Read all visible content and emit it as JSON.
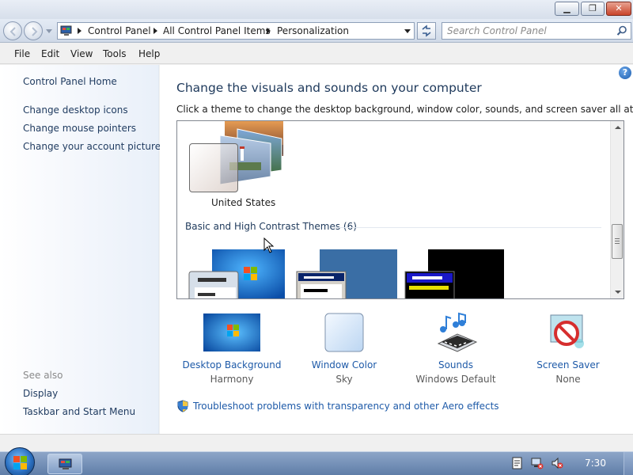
{
  "window": {
    "controls": [
      "minimize",
      "maximize",
      "close"
    ]
  },
  "address_bar": {
    "breadcrumbs": [
      "Control Panel",
      "All Control Panel Items",
      "Personalization"
    ]
  },
  "search": {
    "placeholder": "Search Control Panel"
  },
  "menu": {
    "items": [
      "File",
      "Edit",
      "View",
      "Tools",
      "Help"
    ]
  },
  "sidebar": {
    "home": "Control Panel Home",
    "tasks": [
      "Change desktop icons",
      "Change mouse pointers",
      "Change your account picture"
    ],
    "see_also_heading": "See also",
    "see_also": [
      "Display",
      "Taskbar and Start Menu"
    ]
  },
  "main": {
    "title": "Change the visuals and sounds on your computer",
    "subtitle": "Click a theme to change the desktop background, window color, sounds, and screen saver all at once.",
    "selected_theme": "United States",
    "group_heading": "Basic and High Contrast Themes (6)",
    "options": [
      {
        "label": "Desktop Background",
        "value": "Harmony"
      },
      {
        "label": "Window Color",
        "value": "Sky"
      },
      {
        "label": "Sounds",
        "value": "Windows Default"
      },
      {
        "label": "Screen Saver",
        "value": "None"
      }
    ],
    "troubleshoot_link": "Troubleshoot problems with transparency and other Aero effects"
  },
  "taskbar": {
    "clock": "7:30"
  },
  "colors": {
    "link": "#1e5aa8",
    "title": "#1e395b",
    "sidebar_link": "#1e3a5f",
    "taskbar": "#6f8db6"
  }
}
